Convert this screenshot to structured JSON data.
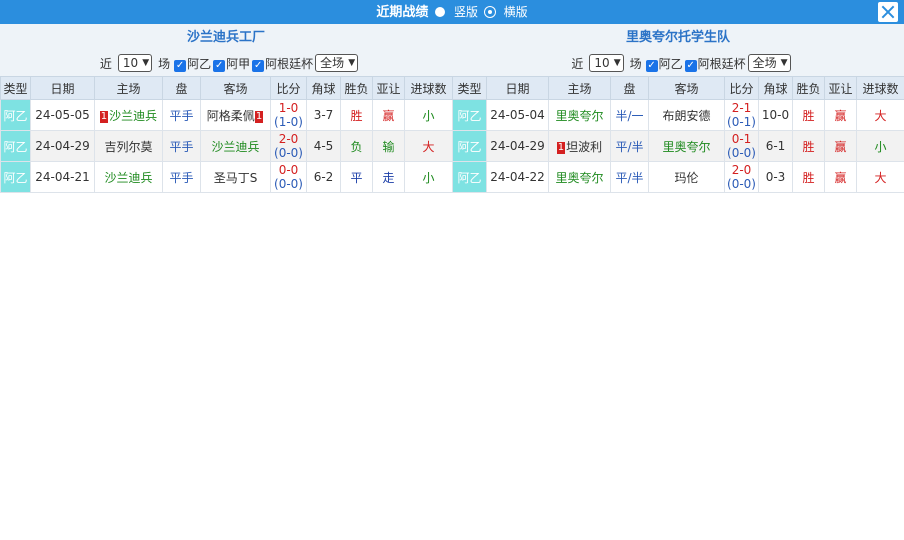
{
  "header": {
    "title": "近期战绩",
    "option_vertical": "竖版",
    "option_horizontal": "横版"
  },
  "columns": [
    "类型",
    "日期",
    "主场",
    "盘",
    "客场",
    "比分",
    "角球",
    "胜负",
    "亚让",
    "进球数"
  ],
  "left": {
    "team": "沙兰迪兵工厂",
    "near_label": "近",
    "count": "10",
    "games_label": "场",
    "checks": [
      "阿乙",
      "阿甲",
      "阿根廷杯"
    ],
    "scope": "全场",
    "rows": [
      {
        "type": "阿乙",
        "date": "24-05-05",
        "home": "沙兰迪兵",
        "home_rank": "1",
        "home_color": "green",
        "line": "平手",
        "away": "阿格柔佩",
        "away_rank": "1",
        "away_color": "black",
        "ft": "1-0",
        "ht": "(1-0)",
        "corner": "3-7",
        "result": "胜",
        "result_color": "red",
        "ah": "赢",
        "ah_color": "red",
        "goals": "小",
        "goals_color": "green"
      },
      {
        "type": "阿乙",
        "date": "24-04-29",
        "home": "吉列尔莫",
        "home_rank": "",
        "home_color": "black",
        "line": "平手",
        "away": "沙兰迪兵",
        "away_rank": "",
        "away_color": "green",
        "ft": "2-0",
        "ht": "(0-0)",
        "corner": "4-5",
        "result": "负",
        "result_color": "green",
        "ah": "输",
        "ah_color": "green",
        "goals": "大",
        "goals_color": "red"
      },
      {
        "type": "阿乙",
        "date": "24-04-21",
        "home": "沙兰迪兵",
        "home_rank": "",
        "home_color": "green",
        "line": "平手",
        "away": "圣马丁S",
        "away_rank": "",
        "away_color": "black",
        "ft": "0-0",
        "ht": "(0-0)",
        "corner": "6-2",
        "result": "平",
        "result_color": "blue",
        "ah": "走",
        "ah_color": "blue",
        "goals": "小",
        "goals_color": "green"
      }
    ]
  },
  "right": {
    "team": "里奥夸尔托学生队",
    "near_label": "近",
    "count": "10",
    "games_label": "场",
    "checks": [
      "阿乙",
      "阿根廷杯"
    ],
    "scope": "全场",
    "rows": [
      {
        "type": "阿乙",
        "date": "24-05-04",
        "home": "里奥夸尔",
        "home_rank": "",
        "home_color": "green",
        "line": "半/一",
        "away": "布朗安德",
        "away_rank": "",
        "away_color": "black",
        "ft": "2-1",
        "ht": "(0-1)",
        "corner": "10-0",
        "result": "胜",
        "result_color": "red",
        "ah": "赢",
        "ah_color": "red",
        "goals": "大",
        "goals_color": "red"
      },
      {
        "type": "阿乙",
        "date": "24-04-29",
        "home": "坦波利",
        "home_rank": "1",
        "home_color": "black",
        "line": "平/半",
        "away": "里奥夸尔",
        "away_rank": "",
        "away_color": "green",
        "ft": "0-1",
        "ht": "(0-0)",
        "corner": "6-1",
        "result": "胜",
        "result_color": "red",
        "ah": "赢",
        "ah_color": "red",
        "goals": "小",
        "goals_color": "green"
      },
      {
        "type": "阿乙",
        "date": "24-04-22",
        "home": "里奥夸尔",
        "home_rank": "",
        "home_color": "green",
        "line": "平/半",
        "away": "玛伦",
        "away_rank": "",
        "away_color": "black",
        "ft": "2-0",
        "ht": "(0-0)",
        "corner": "0-3",
        "result": "胜",
        "result_color": "red",
        "ah": "赢",
        "ah_color": "red",
        "goals": "大",
        "goals_color": "red"
      }
    ]
  }
}
